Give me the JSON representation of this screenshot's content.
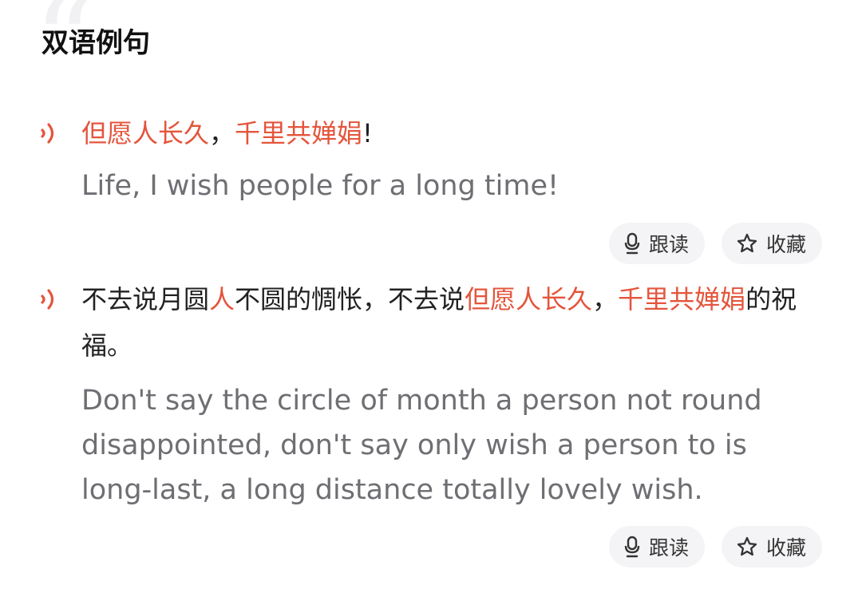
{
  "section": {
    "title": "双语例句"
  },
  "examples": [
    {
      "zh_segments": [
        {
          "text": "但愿人长久",
          "highlight": true
        },
        {
          "text": "，",
          "highlight": false
        },
        {
          "text": "千里共婵娟",
          "highlight": true
        },
        {
          "text": "!",
          "highlight": false
        }
      ],
      "en": "Life, I wish people for a long time!",
      "actions": {
        "follow_read": "跟读",
        "favorite": "收藏"
      }
    },
    {
      "zh_segments": [
        {
          "text": "不去说月圆",
          "highlight": false
        },
        {
          "text": "人",
          "highlight": true
        },
        {
          "text": "不圆的惆怅，不去说",
          "highlight": false
        },
        {
          "text": "但愿人长久",
          "highlight": true
        },
        {
          "text": "，",
          "highlight": false
        },
        {
          "text": "千里共婵娟",
          "highlight": true
        },
        {
          "text": "的祝福。",
          "highlight": false
        }
      ],
      "en": "Don't say the circle of month a person not round disappointed, don't say only wish a person to is long-last, a long distance totally lovely wish.",
      "actions": {
        "follow_read": "跟读",
        "favorite": "收藏"
      }
    }
  ],
  "colors": {
    "highlight": "#e4553c",
    "speaker_icon": "#e4553c",
    "english_text": "#6e6e73",
    "pill_background": "#f4f4f6"
  },
  "icons": {
    "speaker": "speaker-sound-icon",
    "microphone": "microphone-icon",
    "star": "star-outline-icon"
  }
}
